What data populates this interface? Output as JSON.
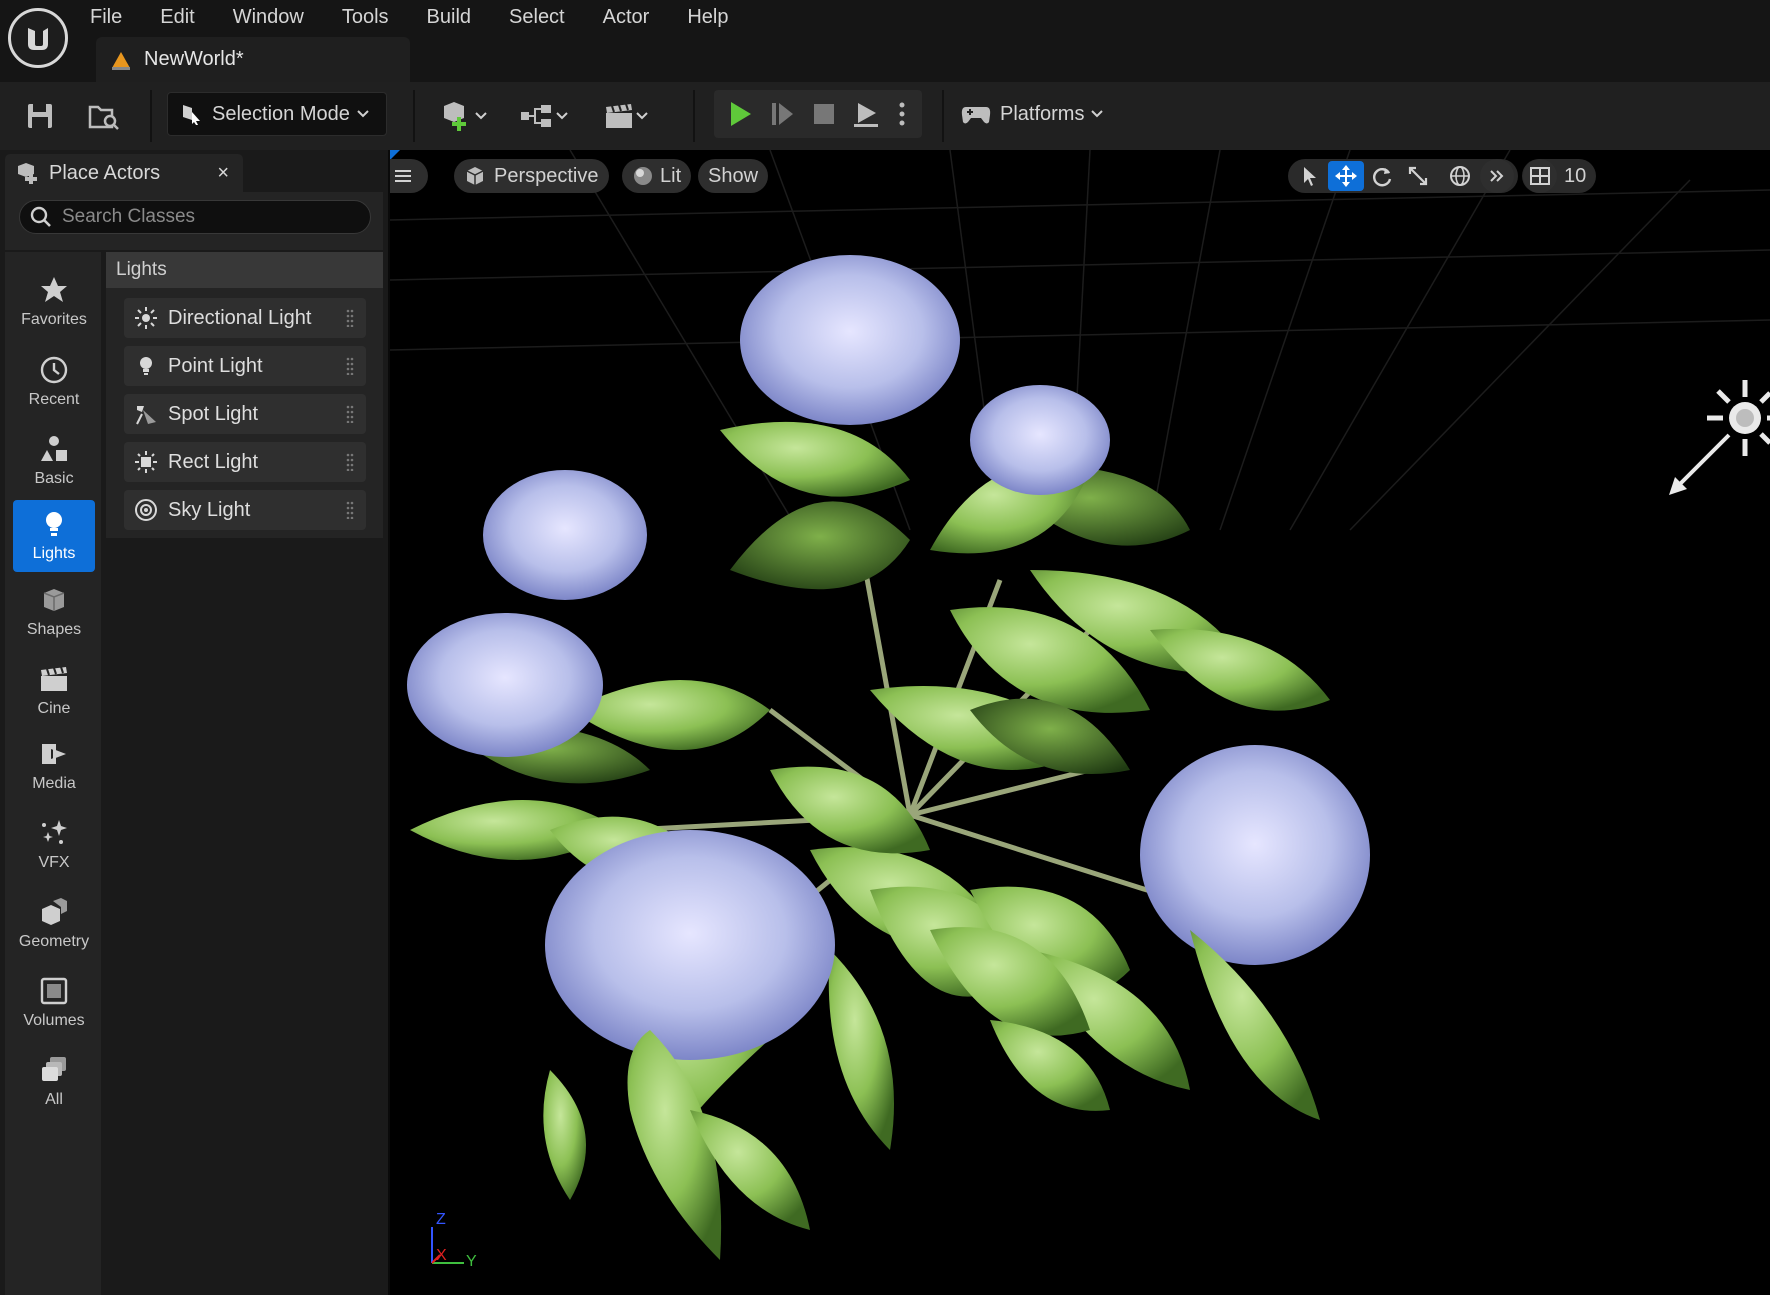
{
  "app": {
    "menu": [
      "File",
      "Edit",
      "Window",
      "Tools",
      "Build",
      "Select",
      "Actor",
      "Help"
    ],
    "document_tab": "NewWorld*"
  },
  "toolbar": {
    "selection_mode": "Selection Mode",
    "platforms": "Platforms"
  },
  "place_actors": {
    "title": "Place Actors",
    "close": "×",
    "search_placeholder": "Search Classes",
    "categories": [
      {
        "label": "Favorites",
        "icon": "star-icon"
      },
      {
        "label": "Recent",
        "icon": "clock-icon"
      },
      {
        "label": "Basic",
        "icon": "basic-shapes-icon"
      },
      {
        "label": "Lights",
        "icon": "lightbulb-icon",
        "active": true
      },
      {
        "label": "Shapes",
        "icon": "cube-icon"
      },
      {
        "label": "Cine",
        "icon": "clapperboard-icon"
      },
      {
        "label": "Media",
        "icon": "media-icon"
      },
      {
        "label": "VFX",
        "icon": "sparkles-icon"
      },
      {
        "label": "Geometry",
        "icon": "geometry-icon"
      },
      {
        "label": "Volumes",
        "icon": "volume-icon"
      },
      {
        "label": "All",
        "icon": "stack-icon"
      }
    ],
    "section_header": "Lights",
    "lights": [
      {
        "label": "Directional Light",
        "icon": "sun-icon"
      },
      {
        "label": "Point Light",
        "icon": "bulb-icon"
      },
      {
        "label": "Spot Light",
        "icon": "spotlight-icon"
      },
      {
        "label": "Rect Light",
        "icon": "rect-light-icon"
      },
      {
        "label": "Sky Light",
        "icon": "sky-light-icon"
      }
    ]
  },
  "viewport": {
    "view_mode": "Perspective",
    "lighting_mode": "Lit",
    "show": "Show",
    "grid_snap_value": "10",
    "axis": {
      "z": "Z",
      "x": "X",
      "y": "Y"
    },
    "colors": {
      "accent": "#0e6fd8",
      "play": "#5fc93a",
      "axis_x": "#e02020",
      "axis_y": "#3fbf3f",
      "axis_z": "#3355ff"
    }
  }
}
